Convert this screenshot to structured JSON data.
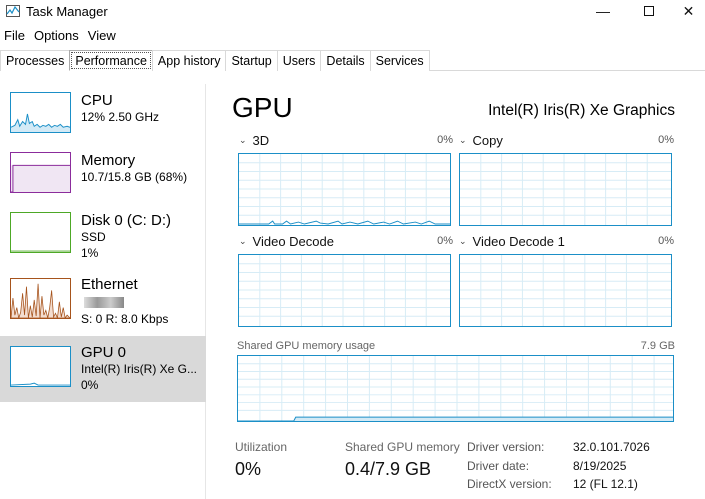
{
  "window": {
    "title": "Task Manager",
    "minimize": "—",
    "close": "✕"
  },
  "menu": [
    "File",
    "Options",
    "View"
  ],
  "tabs": [
    "Processes",
    "Performance",
    "App history",
    "Startup",
    "Users",
    "Details",
    "Services"
  ],
  "active_tab": "Performance",
  "sidebar": [
    {
      "title": "CPU",
      "sub1": "12%  2.50 GHz",
      "color": "#1b8fc7",
      "icon": "cpu-graph"
    },
    {
      "title": "Memory",
      "sub1": "10.7/15.8 GB (68%)",
      "color": "#8b2c9c",
      "icon": "memory-graph"
    },
    {
      "title": "Disk 0 (C: D:)",
      "sub1": "SSD",
      "sub2": "1%",
      "color": "#4da826",
      "icon": "disk-graph"
    },
    {
      "title": "Ethernet",
      "sub2": "S: 0  R: 8.0 Kbps",
      "color": "#a6531c",
      "icon": "ethernet-graph"
    },
    {
      "title": "GPU 0",
      "sub1": "Intel(R) Iris(R) Xe G...",
      "sub2": "0%",
      "color": "#1b8fc7",
      "icon": "gpu-graph"
    }
  ],
  "main": {
    "heading": "GPU",
    "model": "Intel(R) Iris(R) Xe Graphics",
    "engines": [
      {
        "name": "3D",
        "pct": "0%"
      },
      {
        "name": "Copy",
        "pct": "0%"
      },
      {
        "name": "Video Decode",
        "pct": "0%"
      },
      {
        "name": "Video Decode 1",
        "pct": "0%"
      }
    ],
    "shared_memory_label": "Shared GPU memory usage",
    "shared_memory_max": "7.9 GB",
    "stats": {
      "utilization_label": "Utilization",
      "utilization_value": "0%",
      "shared_label": "Shared GPU memory",
      "shared_value": "0.4/7.9 GB"
    },
    "info": [
      {
        "label": "Driver version:",
        "value": "32.0.101.7026"
      },
      {
        "label": "Driver date:",
        "value": "8/19/2025"
      },
      {
        "label": "DirectX version:",
        "value": "12 (FL 12.1)"
      }
    ]
  },
  "colors": {
    "gpu_line": "#1b8fc7",
    "grid": "#d7ecf6",
    "selected_bg": "#d9d9d9"
  }
}
